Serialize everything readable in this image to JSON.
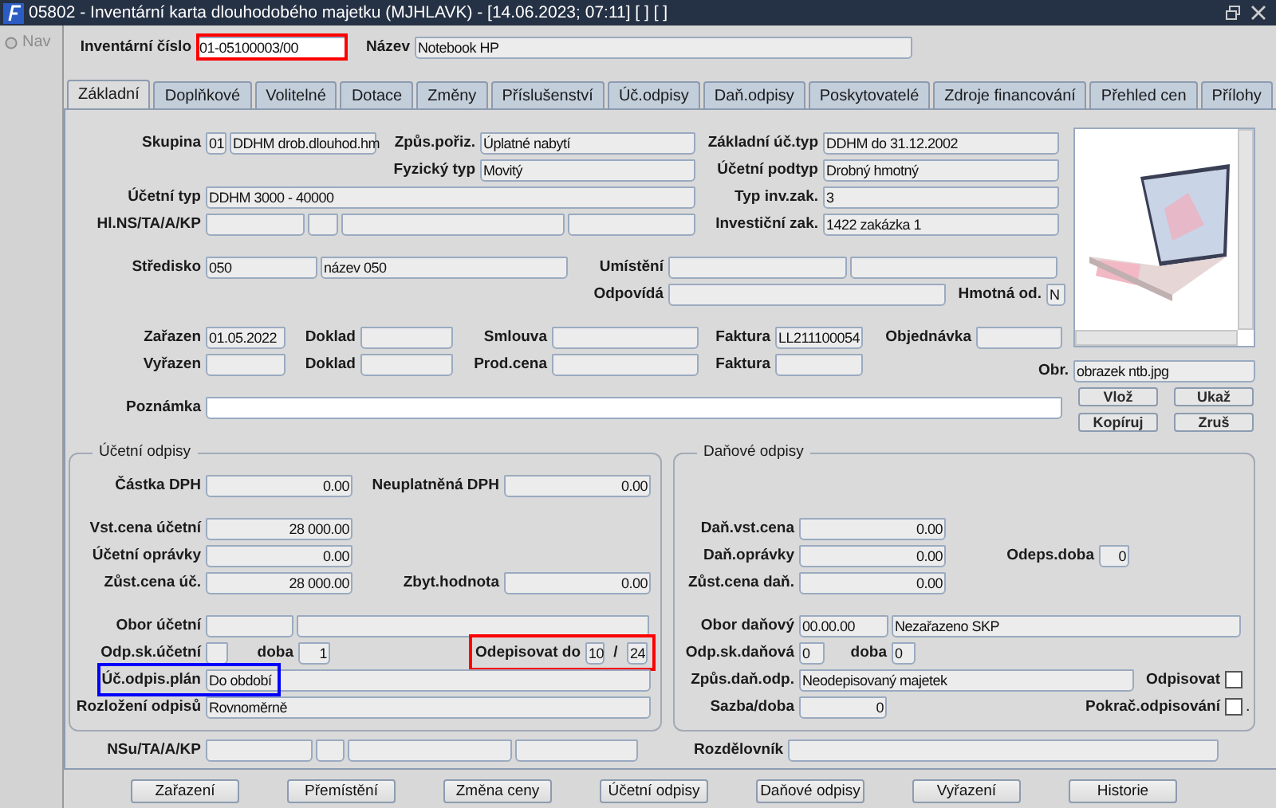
{
  "window": {
    "title": "05802 - Inventární karta dlouhodobého majetku (MJHLAVK) - [14.06.2023; 07:11] [ ] [ ]"
  },
  "nav": {
    "label": "Nav"
  },
  "header": [
    {
      "label": "Inventární číslo",
      "values": [
        "01-05100003/00"
      ],
      "color": "#ff0000",
      "kind": "memo"
    },
    {
      "label": "Název",
      "values": [
        "Notebook HP"
      ]
    }
  ],
  "tabs": [
    {
      "label": "Základní",
      "selected": true
    },
    {
      "label": "Doplňkové",
      "selected": false
    },
    {
      "label": "Volitelné",
      "selected": false
    },
    {
      "label": "Dotace",
      "selected": false
    },
    {
      "label": "Změny",
      "selected": false
    },
    {
      "label": "Příslušenství",
      "selected": false
    },
    {
      "label": "Úč.odpisy",
      "selected": false
    },
    {
      "label": "Daň.odpisy",
      "selected": false
    },
    {
      "label": "Poskytovatelé",
      "selected": false
    },
    {
      "label": "Zdroje financování",
      "selected": false
    },
    {
      "label": "Přehled cen",
      "selected": false
    },
    {
      "label": "Přílohy",
      "selected": false
    }
  ],
  "main": {
    "blocks": [
      [
        {
          "fields": [
            {
              "label": "Skupina",
              "values": [
                "01",
                "DDHM drob.dlouhod.hm"
              ]
            },
            {
              "label": "Způs.pořiz.",
              "values": [
                "Úplatné nabytí"
              ]
            },
            {
              "label": "Základní úč.typ",
              "values": [
                "DDHM do 31.12.2002"
              ]
            }
          ]
        },
        {
          "fields": [
            {
              "label": "Fyzický typ",
              "values": [
                "Movitý"
              ]
            },
            {
              "label": "Účetní podtyp",
              "values": [
                "Drobný hmotný"
              ]
            }
          ]
        },
        {
          "fields": [
            {
              "label": "Účetní typ",
              "values": [
                "DDHM 3000 - 40000"
              ]
            },
            {
              "label": "Typ inv.zak.",
              "values": [
                "3"
              ]
            }
          ]
        },
        {
          "fields": [
            {
              "label": "Hl.NS/TA/A/KP"
            },
            {
              "label": "Investiční zak.",
              "values": [
                "1422 zakázka 1"
              ]
            }
          ]
        }
      ],
      [
        {
          "fields": [
            {
              "label": "Středisko",
              "values": [
                "050",
                "název 050"
              ]
            },
            {
              "label": "Umístění"
            }
          ]
        },
        {
          "fields": [
            {
              "label": "Odpovídá"
            },
            {
              "label": "Hmotná od.",
              "values": [
                "N"
              ]
            }
          ]
        }
      ],
      [
        {
          "fields": [
            {
              "label": "Zařazen",
              "values": [
                "01.05.2022"
              ]
            },
            {
              "label": "Doklad"
            },
            {
              "label": "Smlouva"
            },
            {
              "label": "Faktura",
              "values": [
                "LL211100054"
              ]
            },
            {
              "label": "Objednávka"
            }
          ]
        },
        {
          "fields": [
            {
              "label": "Vyřazen"
            },
            {
              "label": "Doklad"
            },
            {
              "label": "Prod.cena"
            },
            {
              "label": "Faktura"
            }
          ]
        }
      ],
      [
        {
          "fields": [
            {
              "label": "Poznámka",
              "kind": "memo"
            }
          ]
        }
      ]
    ],
    "image": {
      "label": "Obr.",
      "value": "obrazek ntb.jpg"
    },
    "buttons": [
      "Vlož",
      "Ukaž",
      "Kopíruj",
      "Zruš"
    ]
  },
  "groups": [
    {
      "title": "Účetní odpisy",
      "blocks": [
        [
          {
            "fields": [
              {
                "label": "Částka DPH",
                "kind": "number",
                "values": [
                  "0.00"
                ]
              },
              {
                "label": "Neuplatněná DPH",
                "kind": "number",
                "values": [
                  "0.00"
                ]
              }
            ]
          }
        ],
        [
          {
            "fields": [
              {
                "label": "Vst.cena účetní",
                "kind": "number",
                "values": [
                  "28 000.00"
                ]
              }
            ]
          },
          {
            "fields": [
              {
                "label": "Účetní oprávky",
                "kind": "number",
                "values": [
                  "0.00"
                ]
              }
            ]
          },
          {
            "fields": [
              {
                "label": "Zůst.cena úč.",
                "kind": "number",
                "values": [
                  "28 000.00"
                ]
              },
              {
                "label": "Zbyt.hodnota",
                "kind": "number",
                "values": [
                  "0.00"
                ]
              }
            ]
          }
        ],
        [
          {
            "fields": [
              {
                "label": "Obor účetní"
              }
            ]
          },
          {
            "fields": [
              {
                "label": "Odp.sk.účetní"
              },
              {
                "label": "doba",
                "kind": "number",
                "values": [
                  "1"
                ]
              },
              {
                "label": "Odepisovat do",
                "kind": "range",
                "values": [
                  "10",
                  "24"
                ],
                "separator": "/",
                "color": "#ff0000"
              }
            ]
          },
          {
            "fields": [
              {
                "label": "Úč.odpis.plán",
                "values": [
                  "Do období"
                ],
                "color": "#0000ff"
              }
            ]
          },
          {
            "fields": [
              {
                "label": "Rozložení odpisů",
                "values": [
                  "Rovnoměrně"
                ]
              }
            ]
          }
        ]
      ]
    },
    {
      "title": "Daňové odpisy",
      "blocks": [
        [
          {
            "fields": [
              {
                "label": "Daň.vst.cena",
                "kind": "number",
                "values": [
                  "0.00"
                ]
              }
            ]
          },
          {
            "fields": [
              {
                "label": "Daň.oprávky",
                "kind": "number",
                "values": [
                  "0.00"
                ]
              },
              {
                "label": "Odeps.doba",
                "kind": "number",
                "values": [
                  "0"
                ]
              }
            ]
          },
          {
            "fields": [
              {
                "label": "Zůst.cena daň.",
                "kind": "number",
                "values": [
                  "0.00"
                ]
              }
            ]
          }
        ],
        [
          {
            "fields": [
              {
                "label": "Obor daňový",
                "values": [
                  "00.00.00",
                  "Nezařazeno SKP"
                ]
              }
            ]
          },
          {
            "fields": [
              {
                "label": "Odp.sk.daňová",
                "values": [
                  "0"
                ]
              },
              {
                "label": "doba",
                "values": [
                  "0"
                ]
              }
            ]
          },
          {
            "fields": [
              {
                "label": "Způs.daň.odp.",
                "values": [
                  "Neodepisovaný majetek"
                ]
              },
              {
                "label": "Odpisovat",
                "kind": "check",
                "checked": false
              }
            ]
          },
          {
            "fields": [
              {
                "label": "Sazba/doba",
                "kind": "number",
                "values": [
                  "0"
                ]
              },
              {
                "label": "Pokrač.odpisování",
                "kind": "check",
                "checked": false,
                "suffix": "."
              }
            ]
          }
        ]
      ]
    }
  ],
  "bottom": {
    "fields": [
      {
        "label": "NSu/TA/A/KP"
      },
      {
        "label": "Rozdělovník"
      }
    ]
  },
  "actions": [
    "Zařazení",
    "Přemístění",
    "Změna ceny",
    "Účetní odpisy",
    "Daňové odpisy",
    "Vyřazení",
    "Historie"
  ]
}
